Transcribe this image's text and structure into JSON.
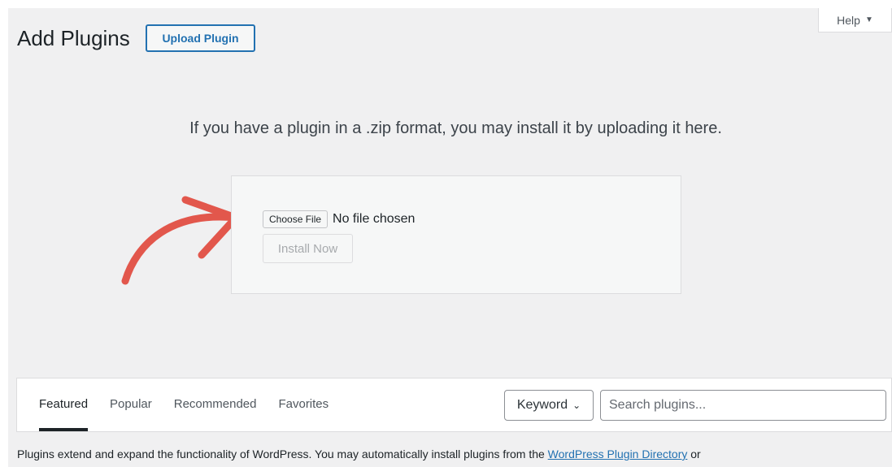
{
  "header": {
    "title": "Add Plugins",
    "upload_button": "Upload Plugin",
    "help_tab": "Help"
  },
  "upload": {
    "help_text": "If you have a plugin in a .zip format, you may install it by uploading it here.",
    "choose_file_label": "Choose File",
    "file_status": "No file chosen",
    "install_button": "Install Now"
  },
  "filter": {
    "tabs": [
      {
        "label": "Featured",
        "active": true
      },
      {
        "label": "Popular",
        "active": false
      },
      {
        "label": "Recommended",
        "active": false
      },
      {
        "label": "Favorites",
        "active": false
      }
    ],
    "search_type": "Keyword",
    "search_placeholder": "Search plugins..."
  },
  "footer": {
    "text_before_link": "Plugins extend and expand the functionality of WordPress. You may automatically install plugins from the ",
    "link_text": "WordPress Plugin Directory",
    "text_after_link": " or"
  },
  "colors": {
    "accent": "#2271b1",
    "arrow": "#e2574c",
    "background": "#f0f0f1"
  },
  "icons": {
    "help_caret": "caret-down-icon",
    "keyword_chevron": "chevron-down-icon",
    "annotation_arrow": "curved-arrow-icon"
  }
}
